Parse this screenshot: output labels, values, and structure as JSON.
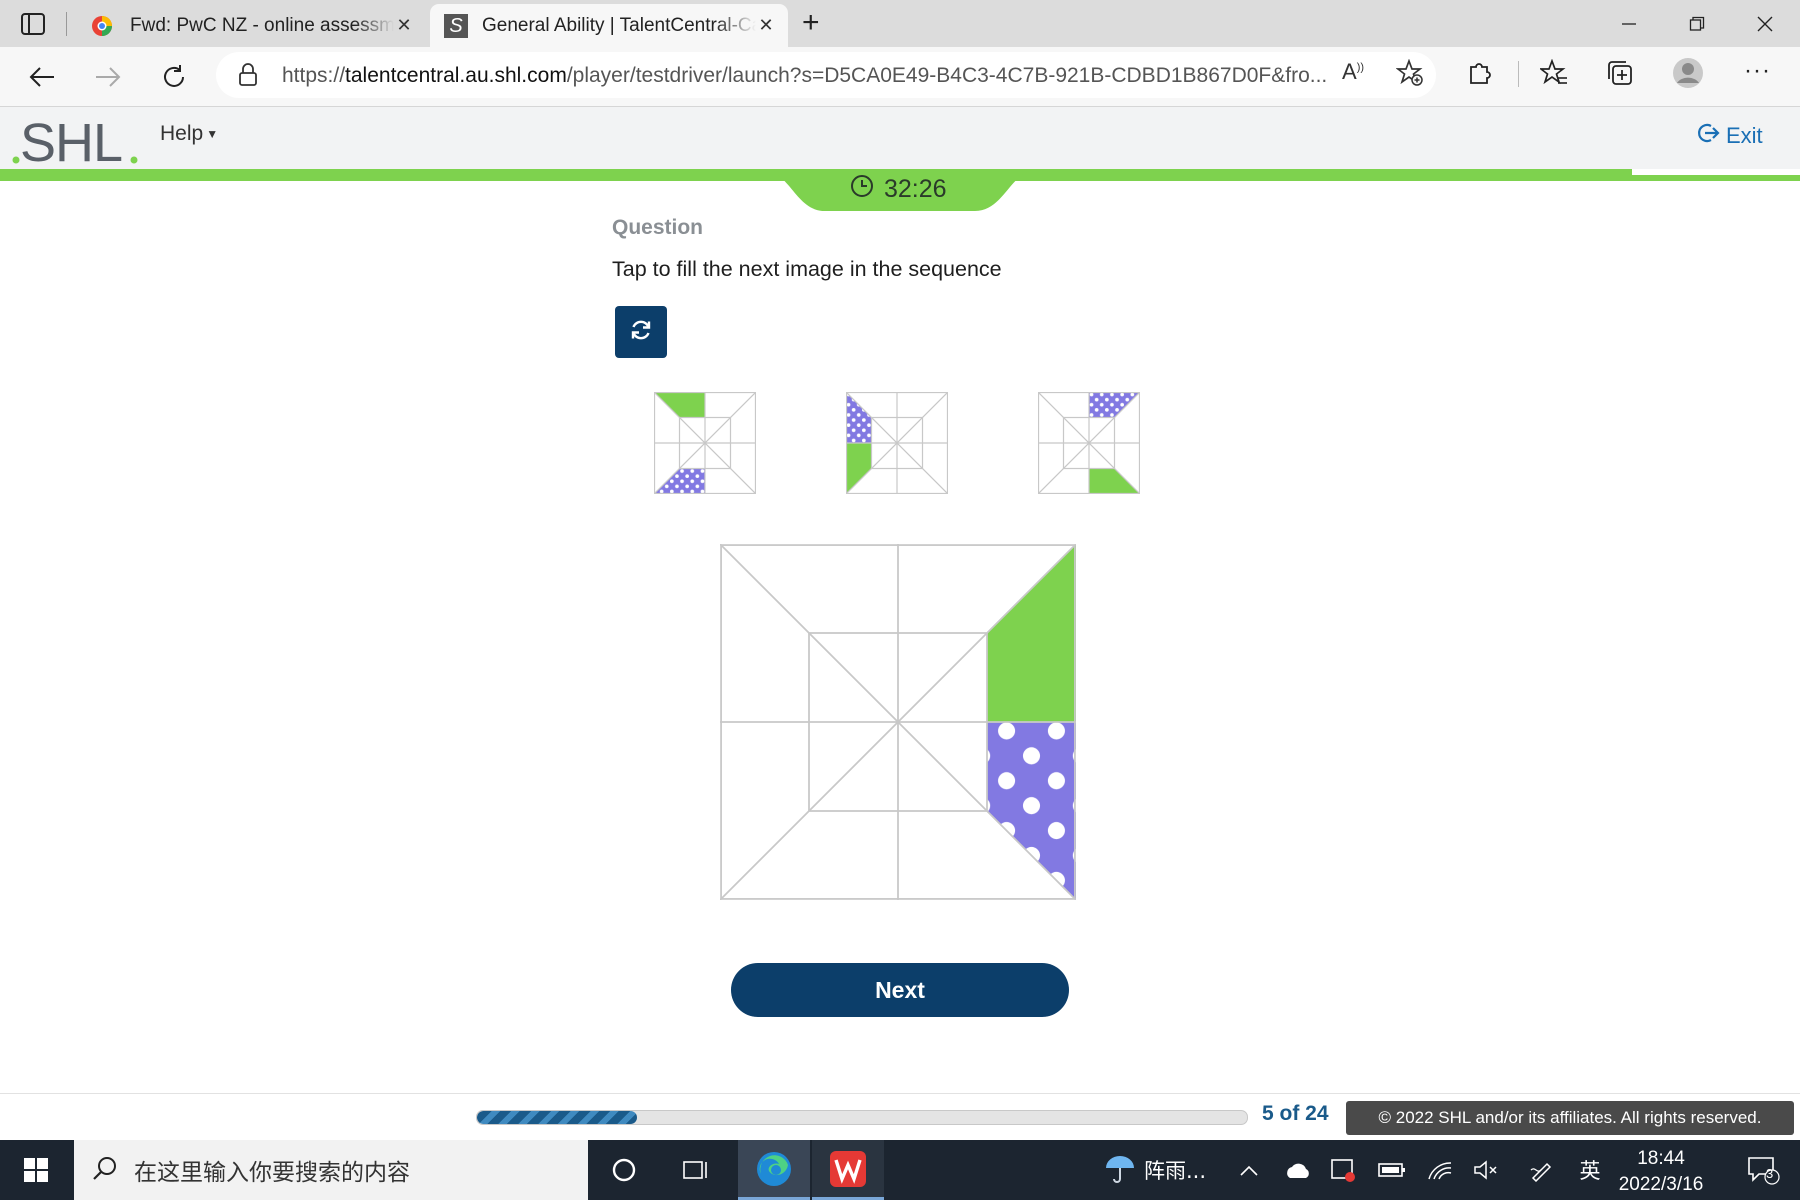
{
  "browser": {
    "tabs": [
      {
        "title": "Fwd: PwC NZ - online assessment",
        "active": false
      },
      {
        "title": "General Ability | TalentCentral-Candidate",
        "active": true
      }
    ],
    "url_prefix": "https://",
    "url_host": "talentcentral.au.shl.com",
    "url_rest": "/player/testdriver/launch?s=D5CA0E49-B4C3-4C7B-921B-CDBD1B867D0F&fro..."
  },
  "shl": {
    "logo_text": "SHL",
    "help_label": "Help",
    "exit_label": "Exit",
    "timer": "32:26"
  },
  "question": {
    "label": "Question",
    "prompt": "Tap to fill the next image in the sequence",
    "reset_icon": "refresh-icon",
    "sequence": [
      {
        "green": "top-left triangle",
        "purple": "bottom-left triangle"
      },
      {
        "green": "left-lower triangle",
        "purple": "left-upper triangle"
      },
      {
        "green": "bottom-right triangle",
        "purple": "top-right triangle"
      }
    ],
    "answer_grid": {
      "green": "right upper half",
      "purple": "right lower half"
    }
  },
  "footer": {
    "next_label": "Next",
    "progress_text": "5 of 24",
    "current": 5,
    "total": 24,
    "copyright": "© 2022 SHL and/or its affiliates. All rights reserved."
  },
  "taskbar": {
    "search_placeholder": "在这里输入你要搜索的内容",
    "weather": "阵雨...",
    "ime": "英",
    "time": "18:44",
    "date": "2022/3/16",
    "notifications": "3"
  },
  "colors": {
    "green": "#7ed24e",
    "purple": "#8279e2",
    "navy": "#0c3e6a",
    "link_blue": "#1a6fb5"
  }
}
